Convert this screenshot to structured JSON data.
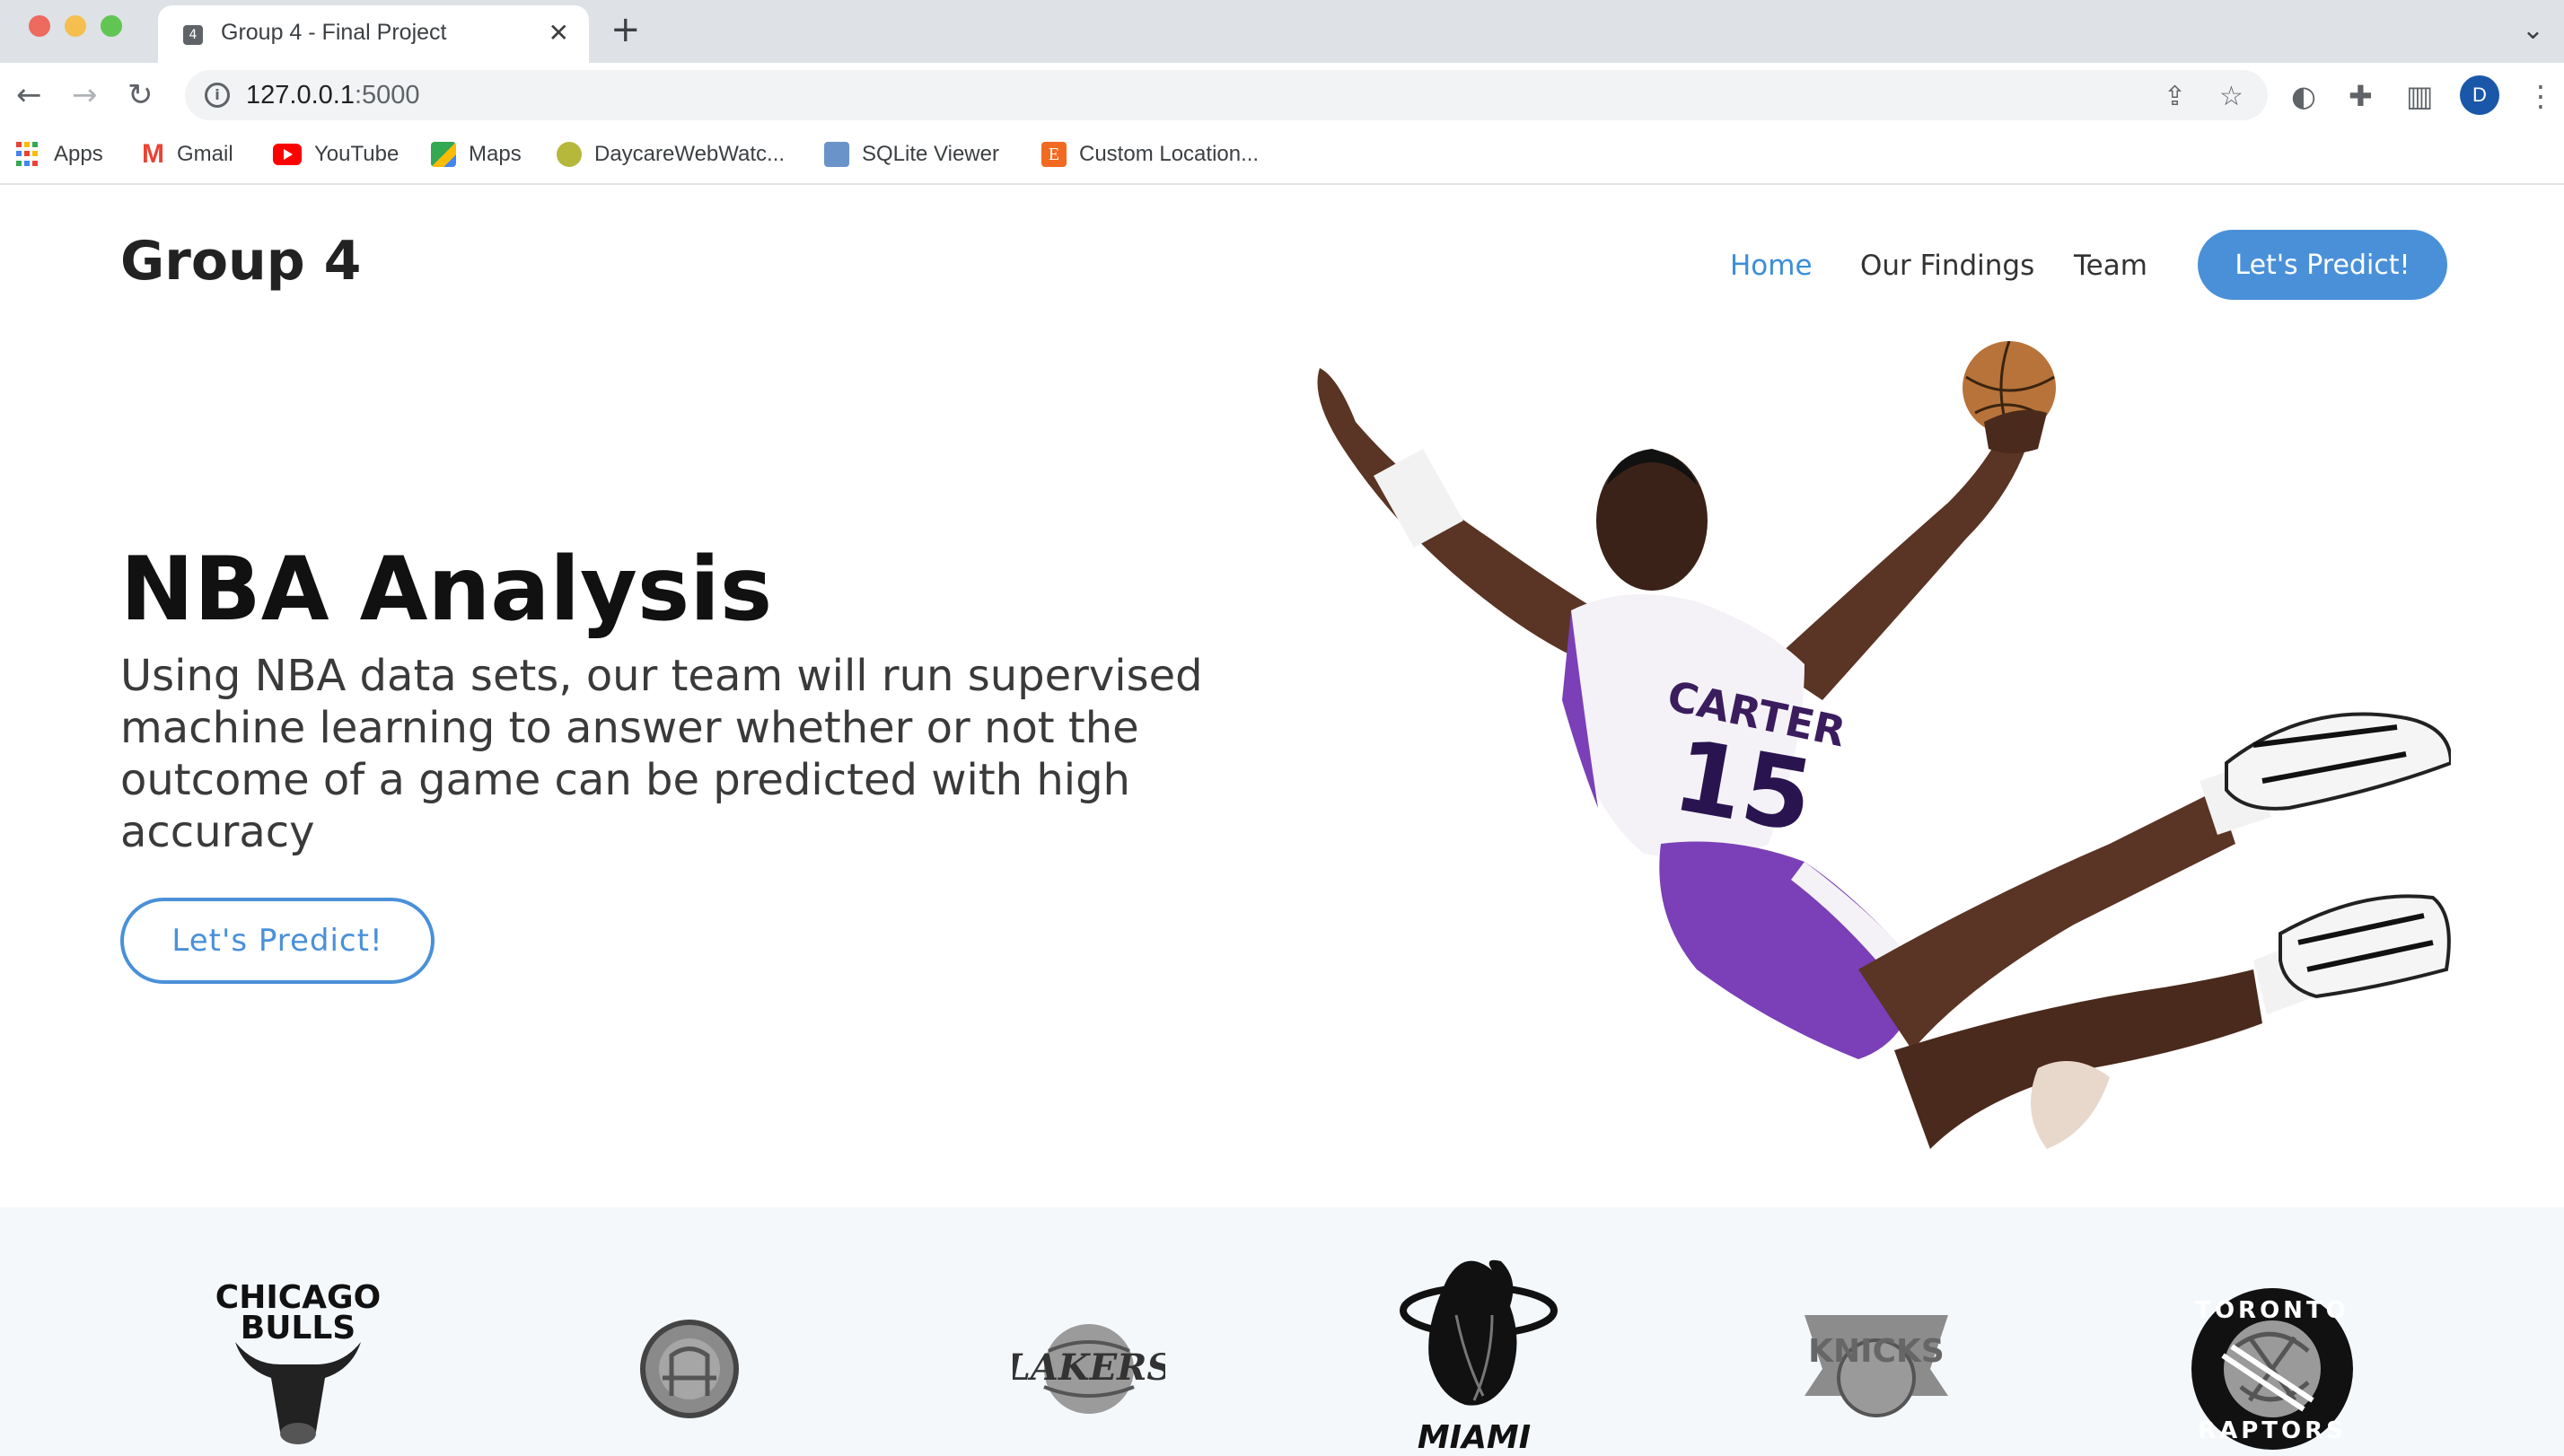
{
  "browser": {
    "tab_title": "Group 4 - Final Project",
    "tab_favicon_text": "4",
    "url_host": "127.0.0.1",
    "url_port": ":5000",
    "profile_initial": "D",
    "bookmarks": [
      {
        "label": "Apps",
        "icon": "apps-grid-icon"
      },
      {
        "label": "Gmail",
        "icon": "gmail-icon"
      },
      {
        "label": "YouTube",
        "icon": "youtube-icon"
      },
      {
        "label": "Maps",
        "icon": "maps-icon"
      },
      {
        "label": "DaycareWebWatc...",
        "icon": "daycare-icon"
      },
      {
        "label": "SQLite Viewer",
        "icon": "sqlite-icon"
      },
      {
        "label": "Custom Location...",
        "icon": "custom-location-icon"
      }
    ]
  },
  "site": {
    "logo": "Group 4",
    "nav": {
      "home": "Home",
      "findings": "Our Findings",
      "team": "Team",
      "cta": "Let's Predict!"
    },
    "hero": {
      "title": "NBA Analysis",
      "subtitle": "Using NBA data sets, our team will run supervised machine learning to answer whether or not the outcome of a game can be predicted with high accuracy",
      "cta": "Let's Predict!"
    },
    "teams": [
      {
        "name": "CHICAGO BULLS",
        "icon": "chicago-bulls-logo"
      },
      {
        "name": "GOLDEN STATE WARRIORS",
        "icon": "warriors-logo"
      },
      {
        "name": "LOS ANGELES LAKERS",
        "icon": "lakers-logo"
      },
      {
        "name": "MIAMI",
        "icon": "miami-heat-logo"
      },
      {
        "name": "NEW YORK KNICKS",
        "icon": "knicks-logo"
      },
      {
        "name": "TORONTO RAPTORS",
        "icon": "raptors-logo"
      }
    ],
    "player_jersey": {
      "name": "CARTER",
      "number": "15"
    }
  },
  "colors": {
    "accent": "#4a90d9",
    "active_link": "#3b8ed8",
    "jersey_purple": "#7b3fb8"
  }
}
